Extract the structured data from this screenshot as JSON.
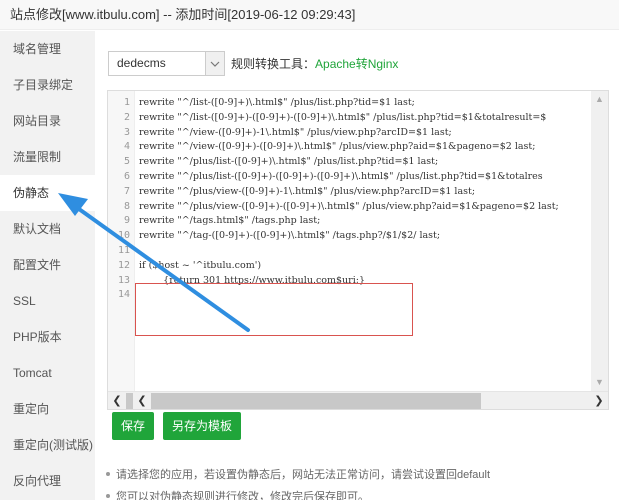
{
  "window": {
    "title": "站点修改[www.itbulu.com] -- 添加时间[2019-06-12 09:29:43]"
  },
  "sidebar": {
    "active_index": 4,
    "items": [
      {
        "label": "域名管理"
      },
      {
        "label": "子目录绑定"
      },
      {
        "label": "网站目录"
      },
      {
        "label": "流量限制"
      },
      {
        "label": "伪静态"
      },
      {
        "label": "默认文档"
      },
      {
        "label": "配置文件"
      },
      {
        "label": "SSL"
      },
      {
        "label": "PHP版本"
      },
      {
        "label": "Tomcat"
      },
      {
        "label": "重定向"
      },
      {
        "label": "重定向(测试版)"
      },
      {
        "label": "反向代理"
      }
    ]
  },
  "toolbar": {
    "template_select": {
      "value": "dedecms",
      "icon": "chevron-down-icon"
    },
    "tool_label": "规则转换工具：",
    "tool_link": "Apache转Nginx"
  },
  "editor": {
    "line_numbers": [
      "1",
      "2",
      "3",
      "4",
      "5",
      "6",
      "7",
      "8",
      "9",
      "10",
      "11",
      "12",
      "13",
      "14"
    ],
    "lines": [
      "rewrite \"^/list-([0-9]+)\\.html$\" /plus/list.php?tid=$1 last;",
      "rewrite \"^/list-([0-9]+)-([0-9]+)-([0-9]+)\\.html$\" /plus/list.php?tid=$1&totalresult=$",
      "rewrite \"^/view-([0-9]+)-1\\.html$\" /plus/view.php?arcID=$1 last;",
      "rewrite \"^/view-([0-9]+)-([0-9]+)\\.html$\" /plus/view.php?aid=$1&pageno=$2 last;",
      "rewrite \"^/plus/list-([0-9]+)\\.html$\" /plus/list.php?tid=$1 last;",
      "rewrite \"^/plus/list-([0-9]+)-([0-9]+)-([0-9]+)\\.html$\" /plus/list.php?tid=$1&totalres",
      "rewrite \"^/plus/view-([0-9]+)-1\\.html$\" /plus/view.php?arcID=$1 last;",
      "rewrite \"^/plus/view-([0-9]+)-([0-9]+)\\.html$\" /plus/view.php?aid=$1&pageno=$2 last;",
      "rewrite \"^/tags.html$\" /tags.php last;",
      "rewrite \"^/tag-([0-9]+)-([0-9]+)\\.html$\" /tags.php?/$1/$2/ last;",
      "",
      "if ($host ~ '^itbulu.com')",
      "        {return 301 https://www.itbulu.com$uri;}",
      ""
    ]
  },
  "buttons": {
    "save": "保存",
    "save_as_template": "另存为模板"
  },
  "tips": [
    "请选择您的应用，若设置伪静态后，网站无法正常访问，请尝试设置回default",
    "您可以对伪静态规则进行修改，修改完后保存即可。"
  ],
  "colors": {
    "accent_green": "#20a53a",
    "highlight_red": "#d9534f",
    "annotation_arrow": "#2f8ee0"
  }
}
